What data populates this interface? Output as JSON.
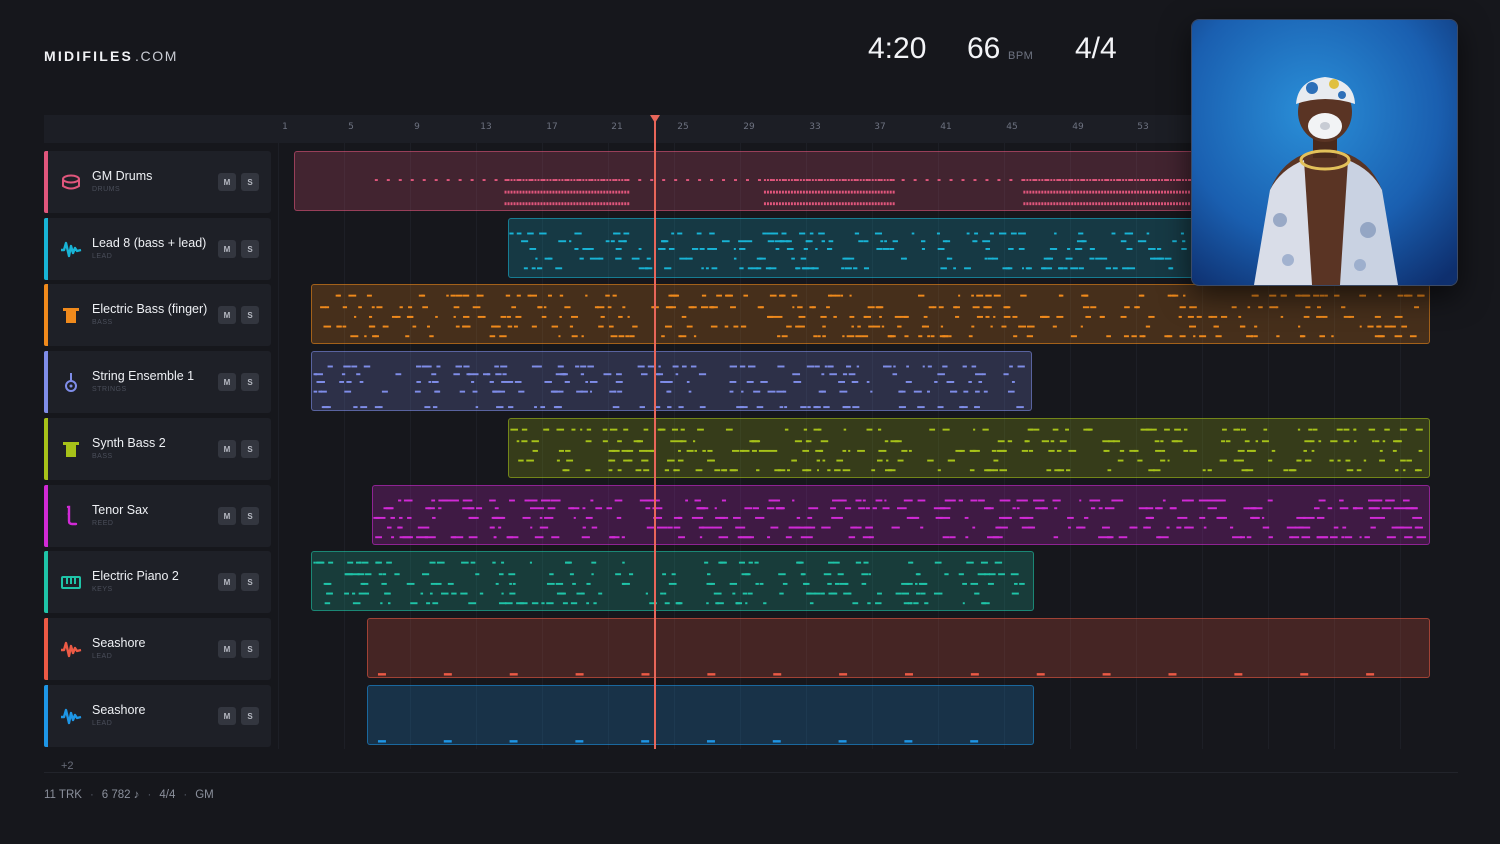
{
  "brand": {
    "primary": "MIDIFILES",
    "secondary": ".COM"
  },
  "stats": {
    "time": "4:20",
    "bpm": "66",
    "bpm_label": "BPM",
    "time_signature": "4/4"
  },
  "ruler": {
    "ticks": [
      "1",
      "5",
      "9",
      "13",
      "17",
      "21",
      "25",
      "29",
      "33",
      "37",
      "41",
      "45",
      "49",
      "53"
    ]
  },
  "tracks": [
    {
      "name": "GM Drums",
      "category": "DRUMS",
      "color": "#e0567c",
      "icon": "drum-icon",
      "mute": "M",
      "solo": "S"
    },
    {
      "name": "Lead 8 (bass + lead)",
      "category": "LEAD",
      "color": "#18b4d6",
      "icon": "waveform-icon",
      "mute": "M",
      "solo": "S"
    },
    {
      "name": "Electric Bass (finger)",
      "category": "BASS",
      "color": "#f08a1c",
      "icon": "bass-icon",
      "mute": "M",
      "solo": "S"
    },
    {
      "name": "String Ensemble 1",
      "category": "STRINGS",
      "color": "#7f8de8",
      "icon": "strings-icon",
      "mute": "M",
      "solo": "S"
    },
    {
      "name": "Synth Bass 2",
      "category": "BASS",
      "color": "#a7c219",
      "icon": "bass-icon",
      "mute": "M",
      "solo": "S"
    },
    {
      "name": "Tenor Sax",
      "category": "REED",
      "color": "#d12ad6",
      "icon": "sax-icon",
      "mute": "M",
      "solo": "S"
    },
    {
      "name": "Electric Piano 2",
      "category": "KEYS",
      "color": "#1fc4a8",
      "icon": "keyboard-icon",
      "mute": "M",
      "solo": "S"
    },
    {
      "name": "Seashore",
      "category": "LEAD",
      "color": "#ec5a45",
      "icon": "waveform-icon",
      "mute": "M",
      "solo": "S"
    },
    {
      "name": "Seashore",
      "category": "LEAD",
      "color": "#1e96e6",
      "icon": "waveform-icon",
      "mute": "M",
      "solo": "S"
    }
  ],
  "more_tracks": "+2",
  "footer": {
    "tracks": "11 TRK",
    "notes": "6 782 ♪",
    "signature": "4/4",
    "standard": "GM"
  }
}
